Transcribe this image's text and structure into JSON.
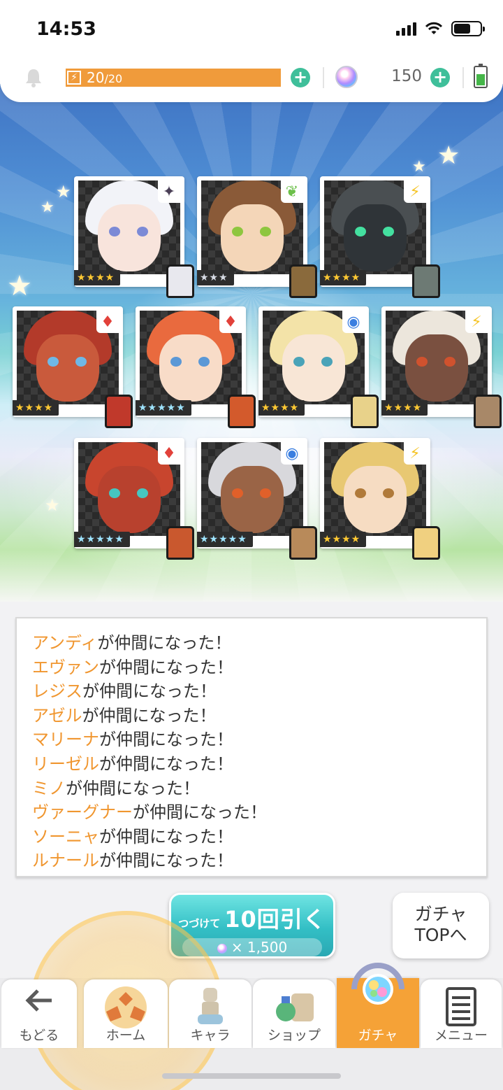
{
  "status_bar": {
    "time": "14:53"
  },
  "hud": {
    "stamina_current": "20",
    "stamina_max": "/20",
    "gem_count": "150",
    "bolt_glyph": "⚡"
  },
  "cards": [
    {
      "element": "dark",
      "element_glyph": "✦",
      "element_color": "#4a3f56",
      "stars": "★★★★",
      "rarity": "gold",
      "hair": "#f2f3f8",
      "skin": "#f8e4dc",
      "eyes": "#7c8ad6",
      "sprite": "#e8e8ee"
    },
    {
      "element": "wind",
      "element_glyph": "❦",
      "element_color": "#6cc04a",
      "stars": "★★★",
      "rarity": "silver",
      "hair": "#8a5a38",
      "skin": "#f4d6b8",
      "eyes": "#8ec63f",
      "sprite": "#8a6a3c"
    },
    {
      "element": "thunder",
      "element_glyph": "⚡",
      "element_color": "#f5c427",
      "stars": "★★★★",
      "rarity": "gold",
      "hair": "#4a4f52",
      "skin": "#2f3438",
      "eyes": "#44e0a0",
      "sprite": "#6d7a74"
    },
    {
      "element": "fire",
      "element_glyph": "♦",
      "element_color": "#e2413a",
      "stars": "★★★★",
      "rarity": "gold",
      "hair": "#b33a2a",
      "skin": "#c95a3c",
      "eyes": "#6fb8e6",
      "sprite": "#c0392b"
    },
    {
      "element": "fire",
      "element_glyph": "♦",
      "element_color": "#e2413a",
      "stars": "★★★★★",
      "rarity": "rainbow",
      "hair": "#e96a3e",
      "skin": "#f8dcc8",
      "eyes": "#5b98d6",
      "sprite": "#d35a2c"
    },
    {
      "element": "water",
      "element_glyph": "◉",
      "element_color": "#3a7ee0",
      "stars": "★★★★",
      "rarity": "gold",
      "hair": "#f3e3a8",
      "skin": "#f8e6d6",
      "eyes": "#4aa3b8",
      "sprite": "#e8d28a"
    },
    {
      "element": "thunder",
      "element_glyph": "⚡",
      "element_color": "#f5c427",
      "stars": "★★★★",
      "rarity": "gold",
      "hair": "#ece6dc",
      "skin": "#7a5040",
      "eyes": "#d0522e",
      "sprite": "#a88868"
    },
    {
      "element": "fire",
      "element_glyph": "♦",
      "element_color": "#e2413a",
      "stars": "★★★★★",
      "rarity": "rainbow",
      "hair": "#c8452e",
      "skin": "#b8412e",
      "eyes": "#46c6c0",
      "sprite": "#c9582e"
    },
    {
      "element": "water",
      "element_glyph": "◉",
      "element_color": "#3a7ee0",
      "stars": "★★★★★",
      "rarity": "rainbow",
      "hair": "#d8d8dc",
      "skin": "#9a6446",
      "eyes": "#e0602a",
      "sprite": "#b88a5a"
    },
    {
      "element": "thunder",
      "element_glyph": "⚡",
      "element_color": "#f5c427",
      "stars": "★★★★",
      "rarity": "gold",
      "hair": "#e8c872",
      "skin": "#f6dcc2",
      "eyes": "#b07a3a",
      "sprite": "#f0d080"
    }
  ],
  "log": {
    "suffix": "が仲間になった！",
    "names": [
      "アンディ",
      "エヴァン",
      "レジス",
      "アゼル",
      "マリーナ",
      "リーゼル",
      "ミノ",
      "ヴァーグナー",
      "ソーニャ",
      "ルナール"
    ]
  },
  "actions": {
    "pull_prefix": "つづけて",
    "pull_title": "10回引く",
    "pull_cost": "× 1,500",
    "gacha_top_line1": "ガチャ",
    "gacha_top_line2": "TOPへ"
  },
  "nav": [
    {
      "id": "back",
      "label": "もどる",
      "icon": "back-arrow-icon",
      "active": false
    },
    {
      "id": "home",
      "label": "ホーム",
      "icon": "home-icon",
      "active": false
    },
    {
      "id": "chara",
      "label": "キャラ",
      "icon": "character-icon",
      "active": false
    },
    {
      "id": "shop",
      "label": "ショップ",
      "icon": "shop-icon",
      "active": false
    },
    {
      "id": "gacha",
      "label": "ガチャ",
      "icon": "gacha-icon",
      "active": true
    },
    {
      "id": "menu",
      "label": "メニュー",
      "icon": "menu-icon",
      "active": false
    }
  ],
  "colors": {
    "accent_orange": "#f5a237",
    "teal": "#3fbf9a",
    "log_name": "#f0962f"
  }
}
